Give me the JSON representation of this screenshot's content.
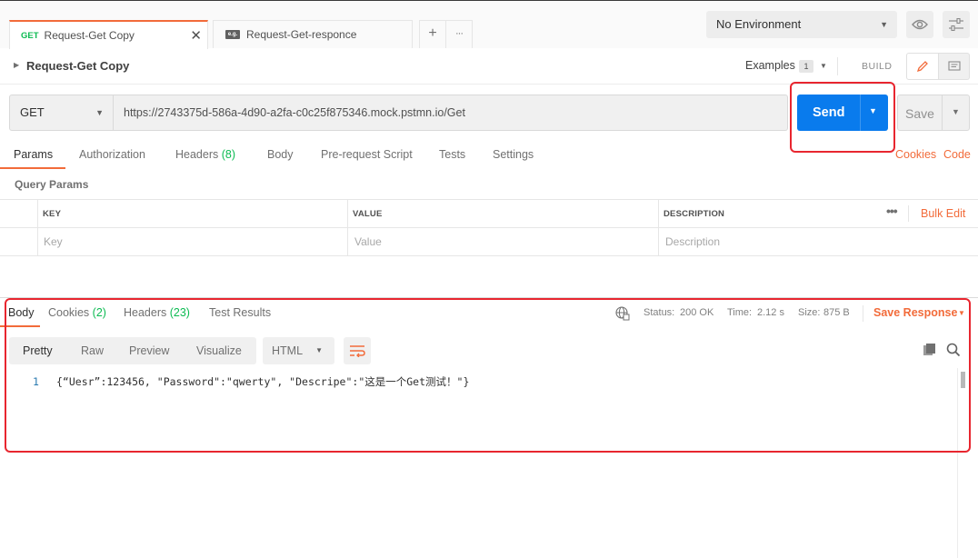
{
  "tabs": [
    {
      "method": "GET",
      "label": "Request-Get Copy",
      "active": true
    },
    {
      "method_icon": "mock-icon",
      "label": "Request-Get-responce",
      "active": false
    }
  ],
  "tab_add": "+",
  "tab_more": "···",
  "environment": {
    "selected": "No Environment"
  },
  "request": {
    "name": "Request-Get Copy",
    "examples_label": "Examples",
    "examples_count": "1",
    "build_label": "BUILD",
    "method": "GET",
    "url": "https://2743375d-586a-4d90-a2fa-c0c25f875346.mock.pstmn.io/Get",
    "send_label": "Send",
    "save_label": "Save"
  },
  "request_tabs": {
    "params": "Params",
    "authorization": "Authorization",
    "headers": "Headers",
    "headers_count": "(8)",
    "body": "Body",
    "prerequest": "Pre-request Script",
    "tests": "Tests",
    "settings": "Settings",
    "cookies": "Cookies",
    "code": "Code"
  },
  "query_params": {
    "title": "Query Params",
    "columns": [
      "KEY",
      "VALUE",
      "DESCRIPTION"
    ],
    "bulk_edit": "Bulk Edit",
    "placeholders": {
      "key": "Key",
      "value": "Value",
      "description": "Description"
    }
  },
  "response": {
    "tabs": {
      "body": "Body",
      "cookies": "Cookies",
      "cookies_count": "(2)",
      "headers": "Headers",
      "headers_count": "(23)",
      "test_results": "Test Results"
    },
    "status_label": "Status:",
    "status_value": "200 OK",
    "time_label": "Time:",
    "time_value": "2.12 s",
    "size_label": "Size:",
    "size_value": "875 B",
    "save_response": "Save Response",
    "view_modes": [
      "Pretty",
      "Raw",
      "Preview",
      "Visualize"
    ],
    "format": "HTML",
    "line_number": "1",
    "body_text": "{“Uesr”:123456, \"Password\":\"qwerty\", \"Descripe\":\"这是一个Get测试！\"}"
  },
  "colors": {
    "accent": "#f26b3a",
    "send_blue": "#097bed",
    "success_green": "#0cbb52",
    "highlight_red": "#e8262f"
  }
}
